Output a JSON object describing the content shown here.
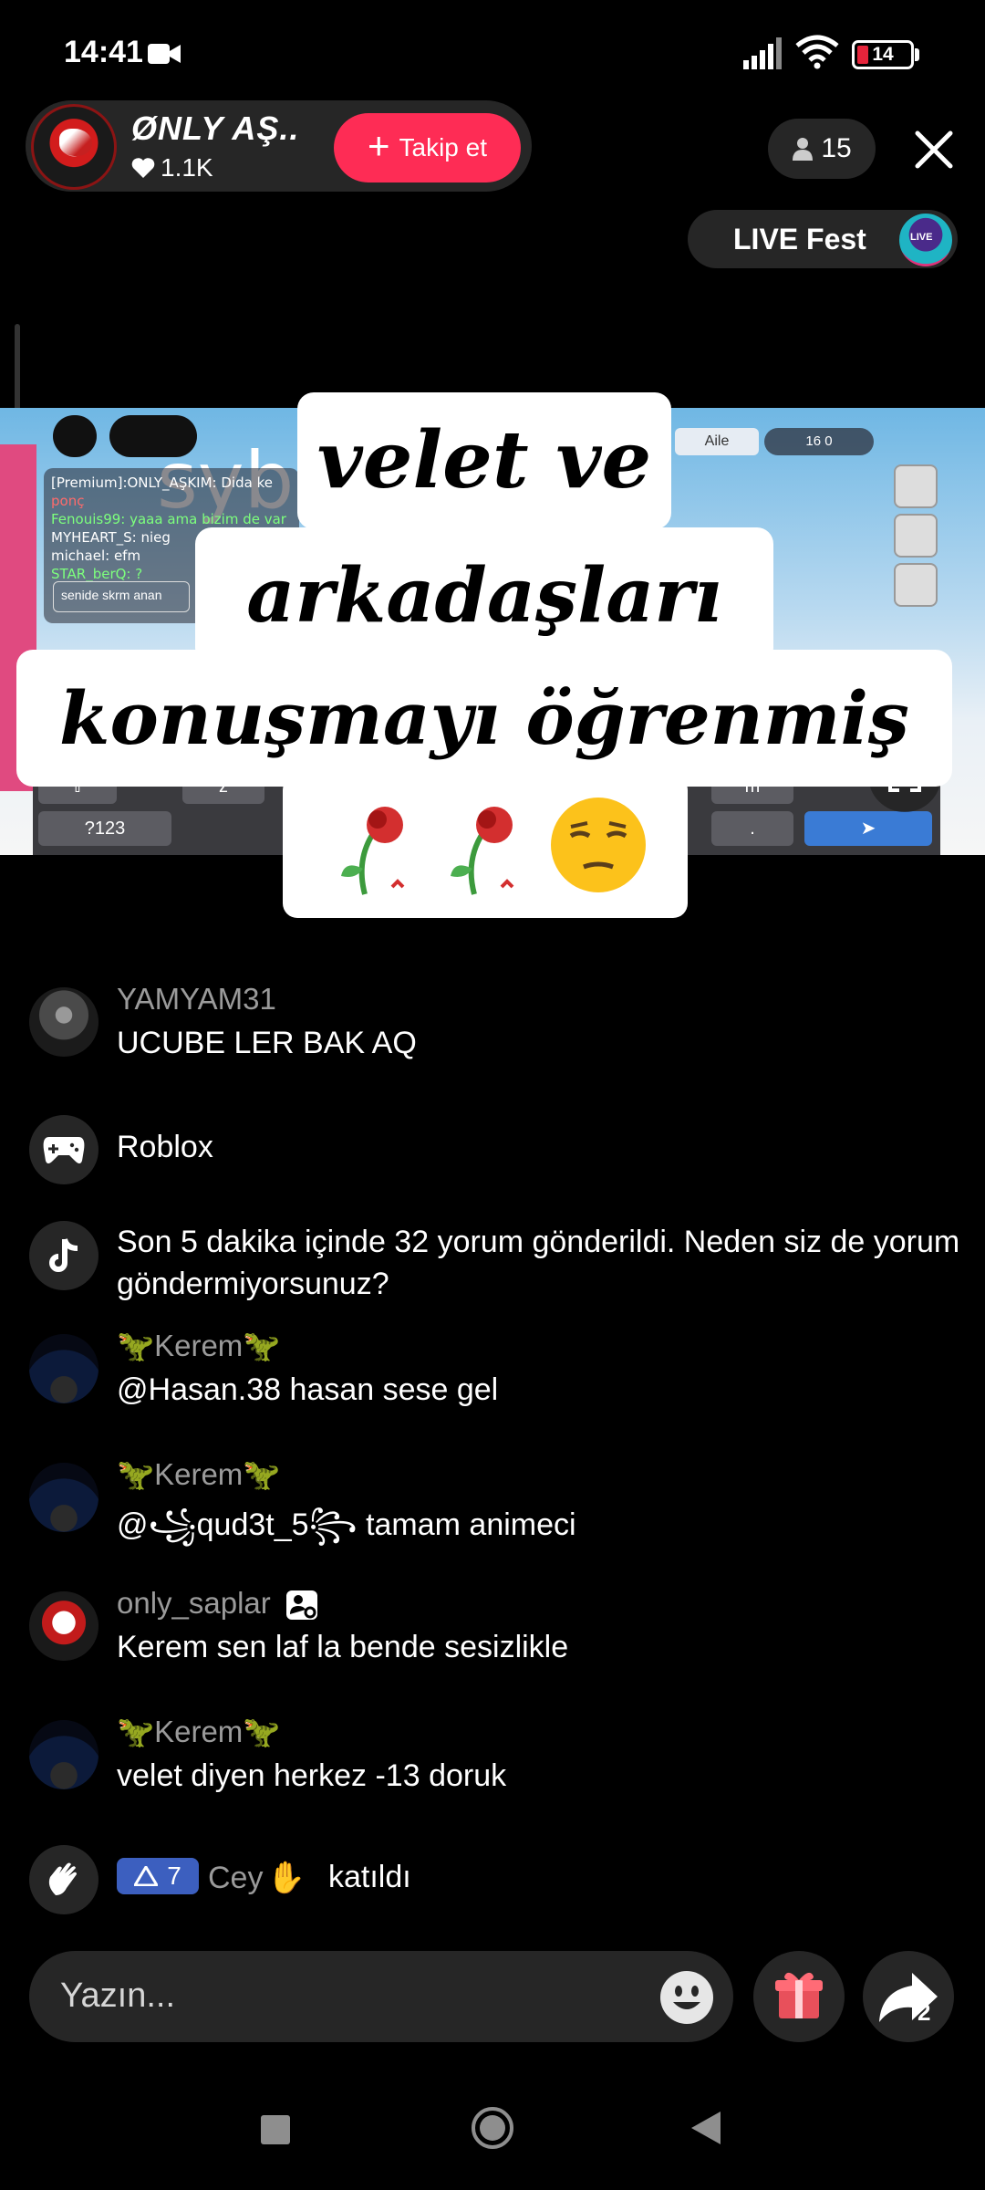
{
  "status_bar": {
    "time": "14:41",
    "battery": "14"
  },
  "host": {
    "name": "ØNLY AŞ..",
    "likes": "1.1K",
    "follow_label": "Takip et"
  },
  "viewers": "15",
  "live_fest": "LIVE Fest",
  "video": {
    "overlay_text": "syb",
    "chat_lines": [
      "[Premium]:ONLY_AŞKIM: Dida ke",
      "ponç",
      "Fenouis99: yaaa ama bizim de var",
      "MYHEART_S: nieg",
      "michael: efm",
      "STAR_berQ: ?"
    ],
    "chat_input": "senide skrm anan",
    "tab_label": "Aile",
    "players": "16  0",
    "keys": {
      "z": "z",
      "m": "m",
      "num": "?123",
      "dot": "."
    }
  },
  "caption": {
    "line1": "velet ve",
    "line2": "arkadaşları",
    "line3": "konuşmayı öğrenmiş"
  },
  "comments": [
    {
      "name": "YAMYAM31",
      "text": "UCUBE LER BAK AQ"
    },
    {
      "text": "Roblox"
    },
    {
      "text": "Son 5 dakika içinde 32 yorum gönderildi. Neden siz de yorum göndermiyorsunuz?"
    },
    {
      "name_core": "Kerem",
      "text": "@Hasan.38 hasan sese gel"
    },
    {
      "name_core": "Kerem",
      "text": "@꧁qud3t_5꧂ tamam animeci"
    },
    {
      "name": "only_saplar",
      "text": "Kerem sen laf la bende sesizlikle"
    },
    {
      "name_core": "Kerem",
      "text": "velet diyen herkez -13 doruk"
    }
  ],
  "join": {
    "level": "7",
    "name": "Cey",
    "action": "katıldı"
  },
  "input": {
    "placeholder": "Yazın..."
  },
  "share_count": "2"
}
